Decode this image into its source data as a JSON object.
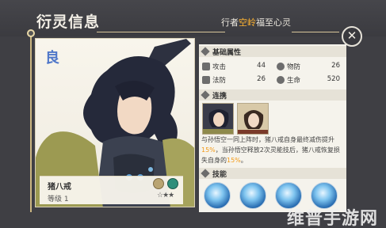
{
  "header": {
    "title": "衍灵信息",
    "tagline_prefix": "行者",
    "tagline_highlight": "空岭",
    "tagline_suffix": "福至心",
    "tagline_end": "灵"
  },
  "close_button": {
    "symbol": "✕"
  },
  "portrait": {
    "seal": "良",
    "name": "猪八戒",
    "level": "等级 1",
    "stars": "☆★★"
  },
  "panel": {
    "basic_section": "基础属性",
    "stats": [
      {
        "label": "攻击",
        "value": "44",
        "icon": "sword-icon"
      },
      {
        "label": "物防",
        "value": "26",
        "icon": "shield-icon"
      },
      {
        "label": "法防",
        "value": "26",
        "icon": "magic-shield-icon"
      },
      {
        "label": "生命",
        "value": "520",
        "icon": "heart-icon"
      }
    ],
    "link_section": "连携",
    "link_desc": {
      "p1": "与孙悟空一同上阵时，猪八戒自身最终减伤提升",
      "v1": "15%",
      "p2": "，当孙悟空释放2次灵能技后，猪八戒恢复损失自身的",
      "v2": "15%",
      "p3": "。"
    },
    "skill_section": "技能"
  },
  "watermark": "维普手游网",
  "colors": {
    "accent": "#f39a18",
    "highlight": "#ffb431",
    "background": "#3f3f44"
  }
}
